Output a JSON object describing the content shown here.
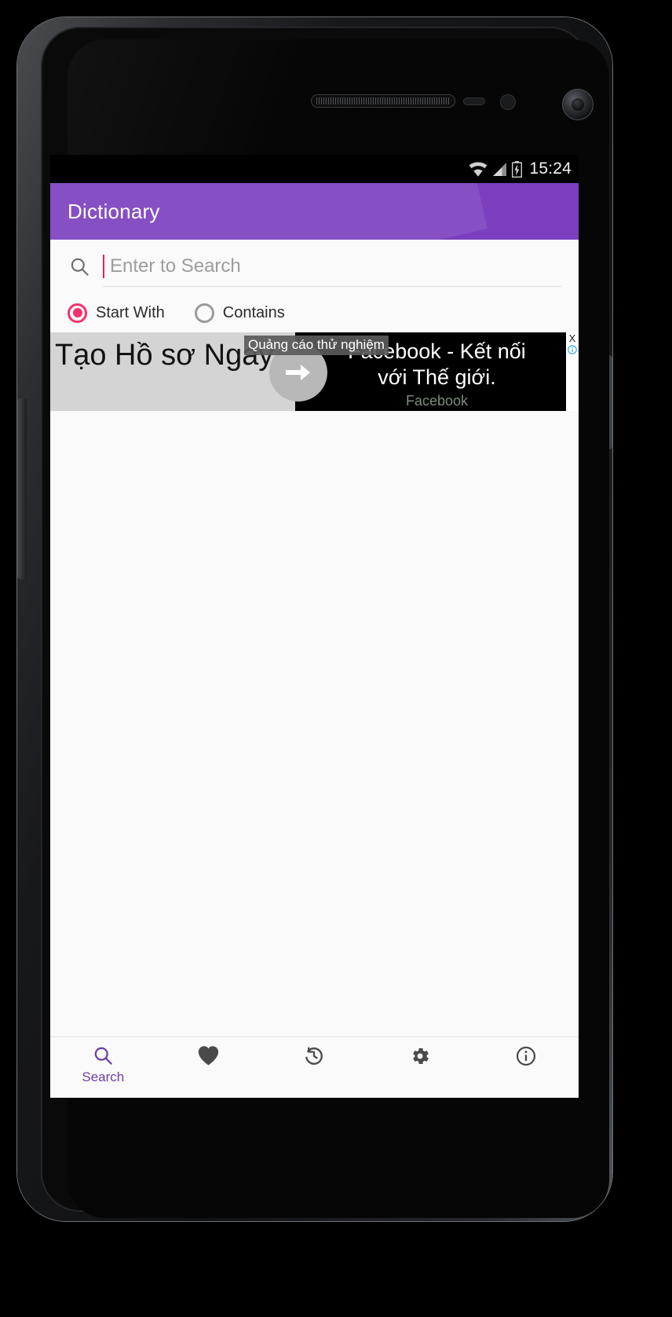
{
  "device": {
    "name": "android-phone",
    "speaker": "earpiece-speaker",
    "camera": "front-camera"
  },
  "status_bar": {
    "time": "15:24",
    "icons": [
      "wifi-icon",
      "cellular-signal-icon",
      "battery-charging-icon"
    ],
    "background": "#000000"
  },
  "action_bar": {
    "title": "Dictionary",
    "background": "#7b3fbf",
    "text_color": "#ffffff"
  },
  "search": {
    "icon": "search-icon",
    "placeholder": "Enter to Search",
    "value": "",
    "caret_color": "#e91e63"
  },
  "match_mode": {
    "selected": "Start With",
    "accent": "#f0336c",
    "options": [
      {
        "label": "Start With",
        "selected": true
      },
      {
        "label": "Contains",
        "selected": false
      }
    ]
  },
  "ad_banner": {
    "badge": "Quảng cáo thử nghiệm",
    "left_headline": "Tạo Hồ sơ Ngay",
    "cta_icon": "arrow-right-icon",
    "title_line1": "Facebook - Kết nối",
    "title_line2": "với Thế giới.",
    "brand": "Facebook",
    "close_label": "X",
    "info_icon": "ad-info-icon",
    "background": "#000000",
    "left_background": "#d4d4d4"
  },
  "bottom_nav": {
    "active_color": "#6b3fa0",
    "inactive_color": "#4a4a4a",
    "items": [
      {
        "label": "Search",
        "icon": "search-icon",
        "active": true
      },
      {
        "label": "",
        "icon": "heart-icon",
        "active": false
      },
      {
        "label": "",
        "icon": "history-icon",
        "active": false
      },
      {
        "label": "",
        "icon": "settings-gear-icon",
        "active": false
      },
      {
        "label": "",
        "icon": "info-icon",
        "active": false
      }
    ]
  }
}
